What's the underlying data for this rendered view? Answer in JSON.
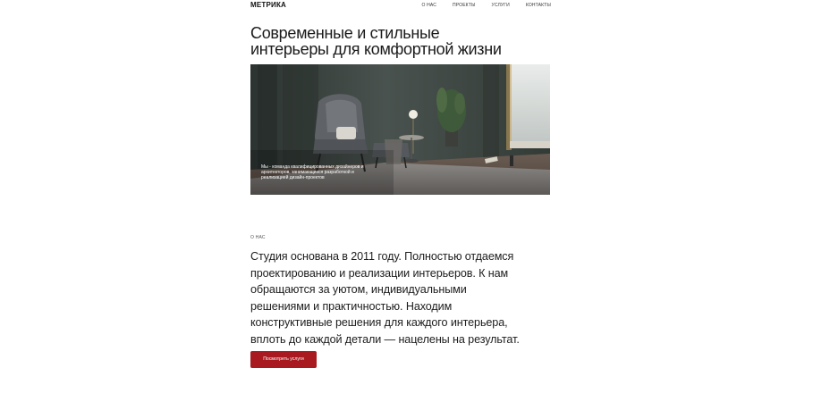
{
  "header": {
    "logo": "МЕТРИКА",
    "nav": [
      "О НАС",
      "ПРОЕКТЫ",
      "УСЛУГИ",
      "КОНТАКТЫ"
    ]
  },
  "hero": {
    "title_line1": "Современные и стильные",
    "title_line2": "интерьеры для комфортной жизни",
    "caption": "Мы - команда квалифицированных дизайнеров и архитекторов, занимающихся разработкой и реализацией дизайн-проектов"
  },
  "about": {
    "eyebrow": "О НАС",
    "text": "Студия основана в 2011 году. Полностью отдаемся проектированию и реализации интерьеров. К нам обращаются за уютом, индивидуальными решениями и практичностью. Находим конструктивные решения для каждого интерьера, вплоть до каждой детали — нацелены на результат.",
    "cta_label": "Посмотреть услуги"
  },
  "colors": {
    "accent": "#a81a1f",
    "background": "#ffffff",
    "text": "#1a1a1a"
  }
}
